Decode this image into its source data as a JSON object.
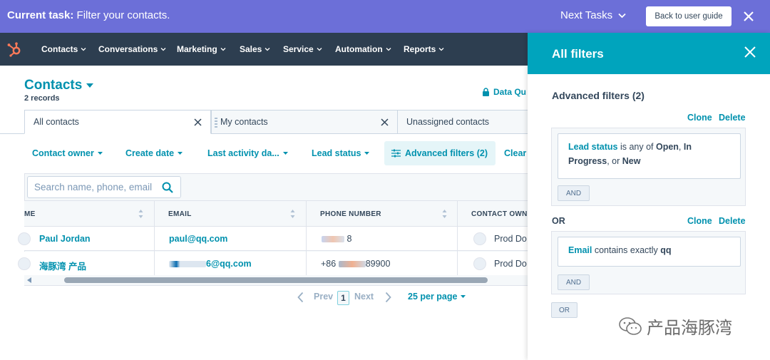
{
  "task": {
    "label": "Current task:",
    "text": "Filter your contacts.",
    "next_tasks": "Next Tasks",
    "back_button": "Back to user guide"
  },
  "nav": {
    "items": [
      "Contacts",
      "Conversations",
      "Marketing",
      "Sales",
      "Service",
      "Automation",
      "Reports"
    ],
    "brand_color": "#ff7a59"
  },
  "page": {
    "title": "Contacts",
    "records": "2 records",
    "data_quality": "Data Qu"
  },
  "tabs": [
    "All contacts",
    "My contacts",
    "Unassigned contacts"
  ],
  "filters": {
    "contact_owner": "Contact owner",
    "create_date": "Create date",
    "last_activity": "Last activity da...",
    "lead_status": "Lead status",
    "advanced": "Advanced filters (2)",
    "clear": "Clear"
  },
  "search": {
    "placeholder": "Search name, phone, email"
  },
  "table": {
    "headers": [
      "ME",
      "EMAIL",
      "PHONE NUMBER",
      "CONTACT OWN"
    ],
    "rows": [
      {
        "name": "Paul Jordan",
        "email": "paul@qq.com",
        "phone_suffix": "8",
        "owner": "Prod Do"
      },
      {
        "name": "海豚湾 产品",
        "email_suffix": "6@qq.com",
        "phone_prefix": "+86",
        "phone_suffix": "89900",
        "owner": "Prod Do"
      }
    ]
  },
  "pagination": {
    "prev": "Prev",
    "page": "1",
    "next": "Next",
    "per_page": "25 per page"
  },
  "panel": {
    "title": "All filters",
    "advanced_title": "Advanced filters (2)",
    "clone": "Clone",
    "delete": "Delete",
    "group1": {
      "property": "Lead status",
      "op": " is any of ",
      "v1": "Open",
      "sep": ", ",
      "v2": "In Progress",
      "or": ", or ",
      "v3": "New"
    },
    "and_label": "AND",
    "or_label": "OR",
    "group2": {
      "property": "Email",
      "op": " contains exactly ",
      "v1": "qq"
    },
    "or_button": "OR"
  },
  "watermark": "产品海豚湾",
  "colors": {
    "accent": "#0091ae",
    "header": "#00a4bd",
    "banner": "#6c6fd8",
    "nav": "#2d3e50"
  }
}
